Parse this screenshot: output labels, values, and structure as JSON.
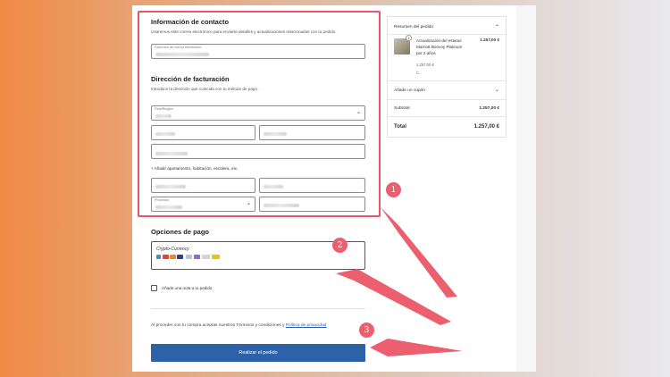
{
  "contact": {
    "heading": "Información de contacto",
    "description": "Usaremos este correo electrónico para enviarte detalles y actualizaciones relacionadas con tu pedido.",
    "email_label": "Dirección de correo electrónico"
  },
  "billing": {
    "heading": "Dirección de facturación",
    "description": "Introduce la dirección que coincida con tu método de pago.",
    "country_label": "País/Región",
    "add_apartment": "+ Añadir apartamento, habitación, escalera, etc.",
    "province_label": "Provincia"
  },
  "payment": {
    "heading": "Opciones de pago",
    "method_label": "Crypto-Currency"
  },
  "note_label": "Añade una nota a tu pedido",
  "terms": {
    "text": "Al proceder con tu compra aceptas nuestros Términos y condiciones y ",
    "link": "Política de privacidad"
  },
  "place_order_label": "Realizar el pedido",
  "summary": {
    "title": "Resumen del pedido",
    "item_name_1": "Actualización del estatus",
    "item_name_2": "Marriott Bonvoy Platinum",
    "item_name_3": "por 2 años",
    "item_price": "1.257,00 €",
    "item_unit_price": "1.257,00 €",
    "item_more": "C...",
    "qty": "1",
    "coupon": "Añade un cupón",
    "subtotal_label": "Subtotal",
    "subtotal_value": "1.257,00 €",
    "total_label": "Total",
    "total_value": "1.257,00 €"
  },
  "markers": [
    "1",
    "2",
    "3"
  ],
  "colors": {
    "highlight": "#e85566",
    "button": "#2e62a8",
    "link": "#2a5db0",
    "marker": "#ec5f6e"
  }
}
